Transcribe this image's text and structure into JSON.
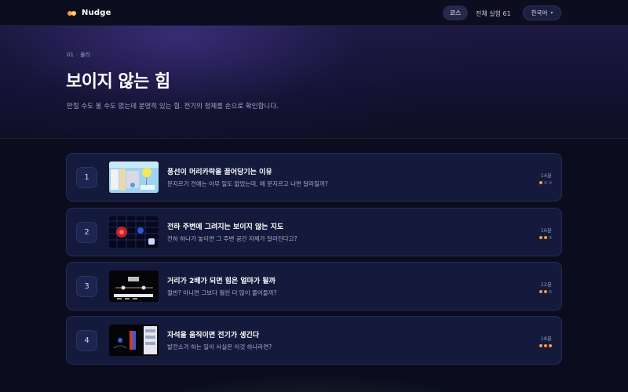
{
  "header": {
    "logo_text": "Nudge",
    "nav_course": "코스",
    "nav_all_experiments": "전체 실험 61",
    "language": "한국어"
  },
  "hero": {
    "breadcrumb_num": "01",
    "breadcrumb_subject": "물리",
    "title": "보이지 않는 힘",
    "description": "만질 수도 볼 수도 없는데 분명히 있는 힘. 전기의 정체를 손으로 확인합니다."
  },
  "lessons": [
    {
      "number": "1",
      "title": "풍선이 머리카락을 끌어당기는 이유",
      "subtitle": "문지르기 전에는 아무 일도 없었는데, 왜 문지르고 나면 달라질까?",
      "duration": "14분",
      "difficulty": 1
    },
    {
      "number": "2",
      "title": "전하 주변에 그려지는 보이지 않는 지도",
      "subtitle": "전하 하나가 놓이면 그 주변 공간 자체가 달라진다고?",
      "duration": "16분",
      "difficulty": 2
    },
    {
      "number": "3",
      "title": "거리가 2배가 되면 힘은 얼마가 될까",
      "subtitle": "절반? 아니면 그보다 훨씬 더 많이 줄어들까?",
      "duration": "12분",
      "difficulty": 2
    },
    {
      "number": "4",
      "title": "자석을 움직이면 전기가 생긴다",
      "subtitle": "발전소가 하는 일이 사실은 이것 하나라면?",
      "duration": "18분",
      "difficulty": 3
    }
  ],
  "colors": {
    "accent": "#ff9a3c",
    "background": "#0b0d1f",
    "card": "#141a3b"
  }
}
